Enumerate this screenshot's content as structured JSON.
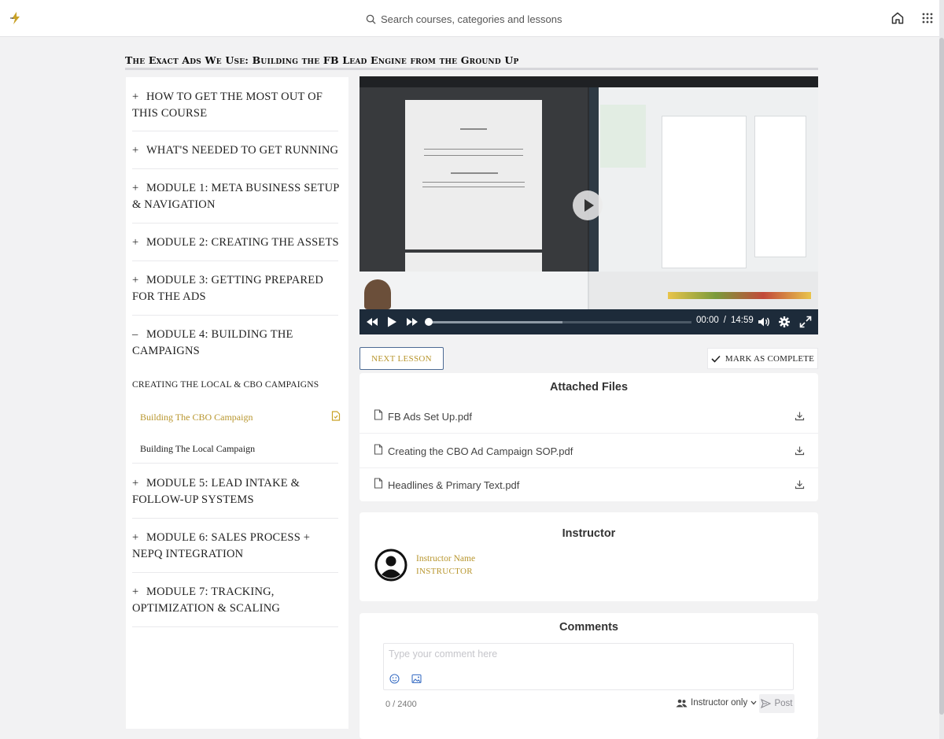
{
  "header": {
    "search_placeholder": "Search courses, categories and lessons",
    "home_icon": "home-icon",
    "apps_icon": "apps-grid-icon"
  },
  "course": {
    "title": "The Exact Ads We Use: Building the FB Lead Engine from the Ground Up"
  },
  "sidebar": {
    "modules": [
      {
        "sign": "+",
        "label": "How to get the most out of this course"
      },
      {
        "sign": "+",
        "label": "What's needed to get running"
      },
      {
        "sign": "+",
        "label": "Module 1: Meta Business Setup & Navigation"
      },
      {
        "sign": "+",
        "label": "Module 2: Creating The Assets"
      },
      {
        "sign": "+",
        "label": "Module 3: Getting Prepared for the Ads"
      },
      {
        "sign": "–",
        "label": "Module 4: Building the Campaigns"
      },
      {
        "sign": "+",
        "label": "Module 5: Lead Intake & Follow-Up Systems"
      },
      {
        "sign": "+",
        "label": "Module 6: Sales Process + NEPQ Integration"
      },
      {
        "sign": "+",
        "label": "Module 7: Tracking, Optimization & Scaling"
      }
    ],
    "section_heading": "Creating the Local & CBO Campaigns",
    "lessons": [
      {
        "label": "Building The CBO Campaign",
        "active": true
      },
      {
        "label": "Building The Local Campaign",
        "active": false
      }
    ]
  },
  "video": {
    "current_time": "00:00",
    "duration": "14:59",
    "progress": 0,
    "buffered": 0.51
  },
  "actions": {
    "next_label": "NEXT LESSON",
    "complete_label": "MARK AS COMPLETE"
  },
  "files": {
    "title": "Attached Files",
    "items": [
      {
        "name": "FB Ads Set Up.pdf"
      },
      {
        "name": "Creating the CBO Ad Campaign SOP.pdf"
      },
      {
        "name": "Headlines & Primary Text.pdf"
      }
    ]
  },
  "instructor": {
    "title": "Instructor",
    "name": "Instructor Name",
    "role": "INSTRUCTOR"
  },
  "comments": {
    "title": "Comments",
    "placeholder": "Type your comment here",
    "char_count": "0 / 2400",
    "visibility": "Instructor only",
    "post_label": "Post"
  },
  "colors": {
    "accent_gold": "#b8962e",
    "player_bar": "#1d2b3a",
    "next_border": "#4c6a93"
  }
}
